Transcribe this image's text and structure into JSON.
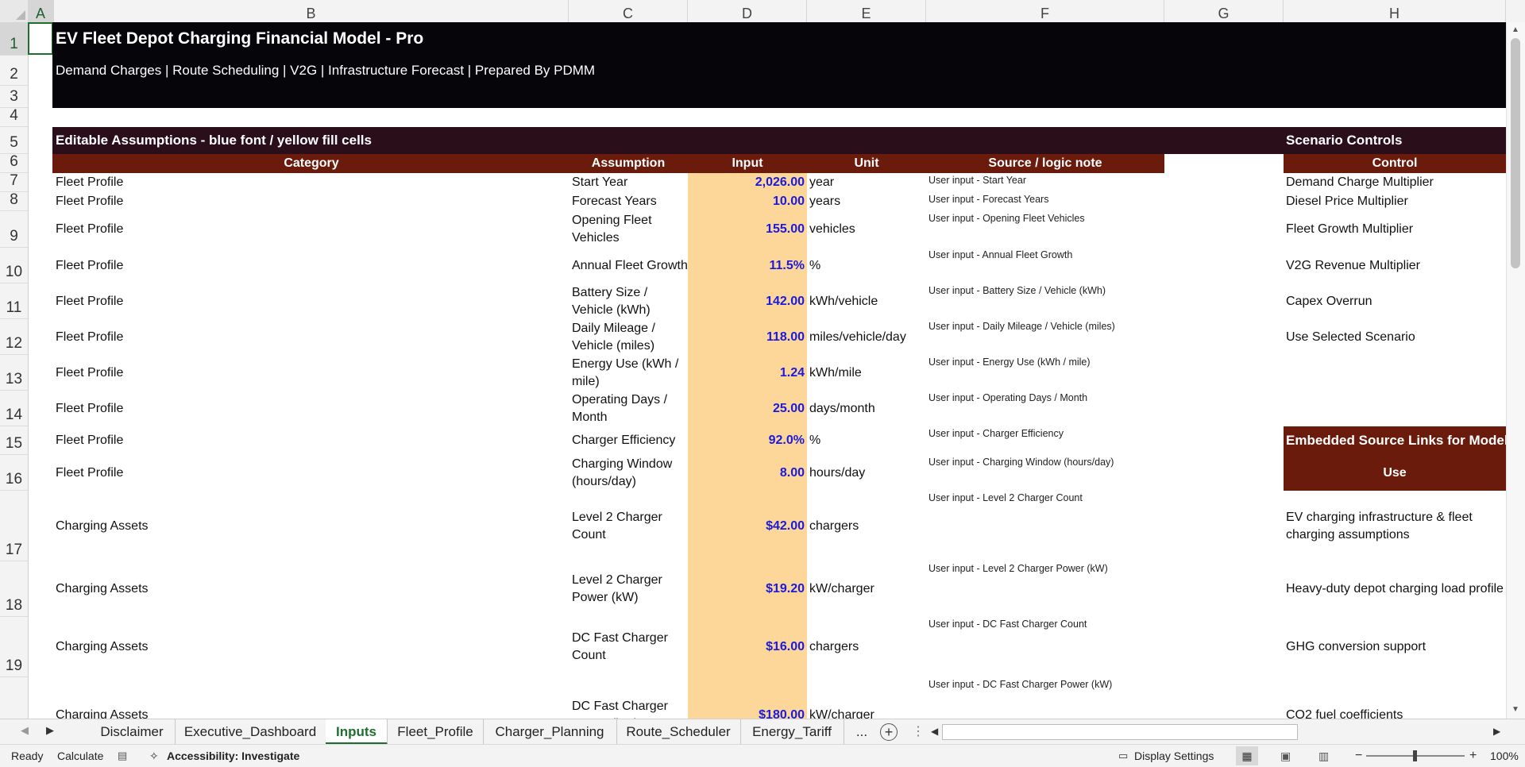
{
  "column_headers": [
    "A",
    "B",
    "C",
    "D",
    "E",
    "F",
    "G",
    "H"
  ],
  "row_headers": [
    "1",
    "2",
    "3",
    "4",
    "5",
    "6",
    "7",
    "8",
    "9",
    "10",
    "11",
    "12",
    "13",
    "14",
    "15",
    "16",
    "17",
    "18",
    "19",
    ""
  ],
  "title": "EV Fleet Depot Charging Financial Model - Pro",
  "subtitle": "Demand Charges | Route Scheduling | V2G | Infrastructure Forecast | Prepared By PDMM",
  "assumptions_section_title": "Editable Assumptions - blue font / yellow fill cells",
  "scenario_section_title": "Scenario Controls",
  "table_headers": {
    "category": "Category",
    "assumption": "Assumption",
    "input": "Input",
    "unit": "Unit",
    "source": "Source / logic note",
    "control": "Control"
  },
  "rows": [
    {
      "category": "Fleet Profile",
      "assumption": "Start Year",
      "input": "2,026.00",
      "unit": "year",
      "note": "User input - Start Year",
      "control": "Demand Charge Multiplier"
    },
    {
      "category": "Fleet Profile",
      "assumption": "Forecast Years",
      "input": "10.00",
      "unit": "years",
      "note": "User input - Forecast Years",
      "control": "Diesel Price Multiplier"
    },
    {
      "category": "Fleet Profile",
      "assumption": "Opening Fleet Vehicles",
      "input": "155.00",
      "unit": "vehicles",
      "note": "User input - Opening Fleet Vehicles",
      "control": "Fleet Growth Multiplier"
    },
    {
      "category": "Fleet Profile",
      "assumption": "Annual Fleet Growth",
      "input": "11.5%",
      "unit": "%",
      "note": "User input - Annual Fleet Growth",
      "control": "V2G Revenue Multiplier"
    },
    {
      "category": "Fleet Profile",
      "assumption": "Battery Size / Vehicle (kWh)",
      "input": "142.00",
      "unit": "kWh/vehicle",
      "note": "User input - Battery Size / Vehicle (kWh)",
      "control": "Capex Overrun"
    },
    {
      "category": "Fleet Profile",
      "assumption": "Daily Mileage / Vehicle (miles)",
      "input": "118.00",
      "unit": "miles/vehicle/day",
      "note": "User input - Daily Mileage / Vehicle (miles)",
      "control": "Use Selected Scenario"
    },
    {
      "category": "Fleet Profile",
      "assumption": "Energy Use (kWh / mile)",
      "input": "1.24",
      "unit": "kWh/mile",
      "note": "User input - Energy Use (kWh / mile)",
      "control": ""
    },
    {
      "category": "Fleet Profile",
      "assumption": "Operating Days / Month",
      "input": "25.00",
      "unit": "days/month",
      "note": "User input - Operating Days / Month",
      "control": ""
    },
    {
      "category": "Fleet Profile",
      "assumption": "Charger Efficiency",
      "input": "92.0%",
      "unit": "%",
      "note": "User input - Charger Efficiency",
      "control": ""
    },
    {
      "category": "Fleet Profile",
      "assumption": "Charging Window (hours/day)",
      "input": "8.00",
      "unit": "hours/day",
      "note": "User input - Charging Window (hours/day)",
      "control": ""
    },
    {
      "category": "Charging Assets",
      "assumption": "Level 2 Charger Count",
      "input": "$42.00",
      "unit": "chargers",
      "note": "User input - Level 2 Charger Count",
      "control": "EV charging infrastructure & fleet charging assumptions"
    },
    {
      "category": "Charging Assets",
      "assumption": "Level 2 Charger Power (kW)",
      "input": "$19.20",
      "unit": "kW/charger",
      "note": "User input - Level 2 Charger Power (kW)",
      "control": "Heavy-duty depot charging load profile"
    },
    {
      "category": "Charging Assets",
      "assumption": "DC Fast Charger Count",
      "input": "$16.00",
      "unit": "chargers",
      "note": "User input - DC Fast Charger Count",
      "control": "GHG conversion support"
    },
    {
      "category": "Charging Assets",
      "assumption": "DC Fast Charger Power (kW)",
      "input": "$180.00",
      "unit": "kW/charger",
      "note": "User input - DC Fast Charger Power (kW)",
      "control": "CO2 fuel coefficients"
    }
  ],
  "embedded_links": {
    "title": "Embedded Source Links for Model",
    "use_header": "Use"
  },
  "sheet_tabs": [
    "Disclaimer",
    "Executive_Dashboard",
    "Inputs",
    "Fleet_Profile",
    "Charger_Planning",
    "Route_Scheduler",
    "Energy_Tariff"
  ],
  "active_tab": "Inputs",
  "tab_more": "...",
  "status": {
    "ready": "Ready",
    "calculate": "Calculate",
    "accessibility": "Accessibility: Investigate",
    "display_settings": "Display Settings",
    "zoom": "100%"
  },
  "colors": {
    "title_band": "#05050a",
    "section_band": "#2a0e1a",
    "header_band": "#6b1b0c",
    "input_fill": "#fdd79a",
    "input_text": "#1a1adf"
  }
}
